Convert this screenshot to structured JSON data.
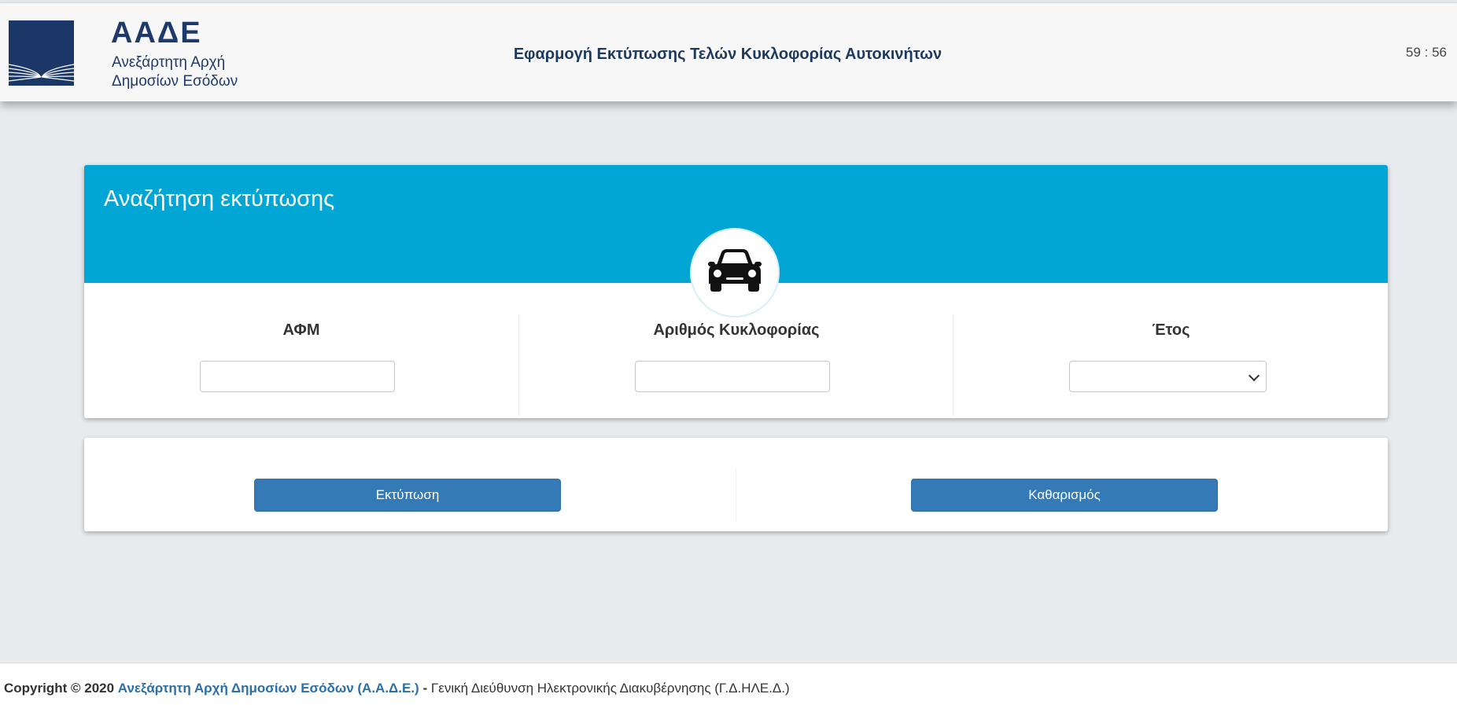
{
  "header": {
    "brand_title": "ΑΑΔΕ",
    "brand_sub_line1": "Ανεξάρτητη Αρχή",
    "brand_sub_line2": "Δημοσίων Εσόδων",
    "app_title": "Εφαρμογή Εκτύπωσης Τελών Κυκλοφορίας Αυτοκινήτων",
    "session_timer": "59 : 56"
  },
  "search_card": {
    "title": "Αναζήτηση εκτύπωσης",
    "icon": "car-icon",
    "accent_color": "#02a6d4",
    "fields": [
      {
        "label": "ΑΦΜ",
        "value": "",
        "type": "text"
      },
      {
        "label": "Αριθμός Κυκλοφορίας",
        "value": "",
        "type": "text"
      },
      {
        "label": "Έτος",
        "value": "",
        "type": "select"
      }
    ]
  },
  "actions": {
    "print_label": "Εκτύπωση",
    "clear_label": "Καθαρισμός",
    "button_color": "#337ab7"
  },
  "footer": {
    "copyright": "Copyright © 2020",
    "org_link": "Ανεξάρτητη Αρχή Δημοσίων Εσόδων (Α.Α.Δ.Ε.)",
    "separator": "-",
    "division": "Γενική Διεύθυνση Ηλεκτρονικής Διακυβέρνησης (Γ.Δ.ΗΛΕ.Δ.)"
  }
}
